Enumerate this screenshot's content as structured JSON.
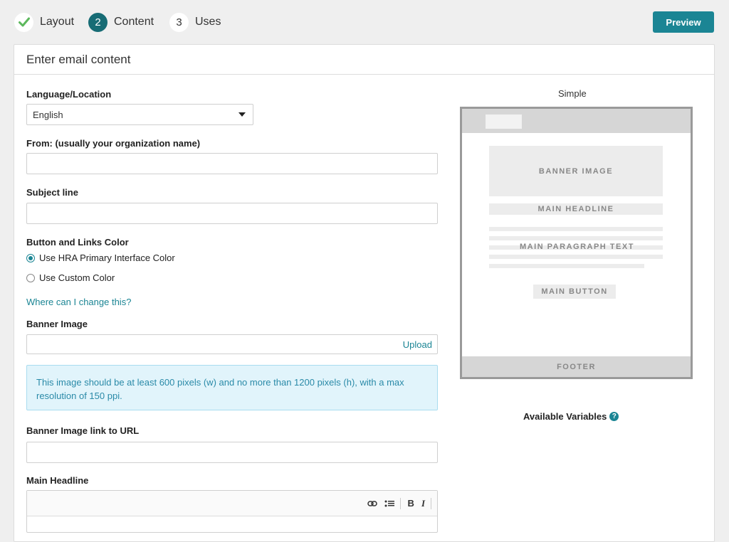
{
  "stepper": {
    "steps": [
      {
        "number": "",
        "label": "Layout",
        "state": "done"
      },
      {
        "number": "2",
        "label": "Content",
        "state": "active"
      },
      {
        "number": "3",
        "label": "Uses",
        "state": "todo"
      }
    ],
    "preview_label": "Preview"
  },
  "card": {
    "title": "Enter email content"
  },
  "form": {
    "language": {
      "label": "Language/Location",
      "value": "English"
    },
    "from": {
      "label": "From: (usually your organization name)",
      "value": ""
    },
    "subject": {
      "label": "Subject line",
      "value": ""
    },
    "button_color": {
      "label": "Button and Links Color",
      "options": [
        {
          "label": "Use HRA Primary Interface Color",
          "selected": true
        },
        {
          "label": "Use Custom Color",
          "selected": false
        }
      ],
      "help_link": "Where can I change this?"
    },
    "banner_image": {
      "label": "Banner Image",
      "upload_label": "Upload",
      "info": "This image should be at least 600 pixels (w) and no more than 1200 pixels (h), with a max resolution of 150 ppi."
    },
    "banner_link": {
      "label": "Banner Image link to URL",
      "value": ""
    },
    "main_headline": {
      "label": "Main Headline",
      "toolbar": {
        "bold": "B",
        "italic": "I"
      }
    }
  },
  "preview": {
    "title": "Simple",
    "banner": "BANNER IMAGE",
    "headline": "MAIN HEADLINE",
    "paragraph": "MAIN PARAGRAPH TEXT",
    "button": "MAIN BUTTON",
    "footer": "FOOTER"
  },
  "variables": {
    "label": "Available Variables",
    "help": "?"
  },
  "colors": {
    "accent": "#1b8594",
    "active_step": "#176c75",
    "info_bg": "#e1f4fb"
  }
}
